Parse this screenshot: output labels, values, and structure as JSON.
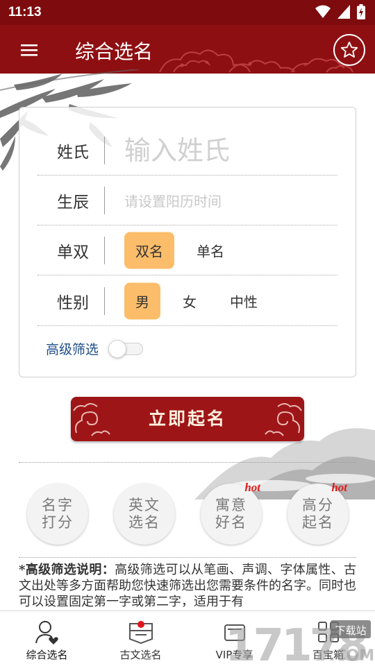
{
  "status_bar": {
    "time": "11:13"
  },
  "app_bar": {
    "title": "综合选名"
  },
  "form": {
    "surname": {
      "label": "姓氏",
      "placeholder": "输入姓氏"
    },
    "birth": {
      "label": "生辰",
      "placeholder": "请设置阳历时间"
    },
    "count": {
      "label": "单双",
      "options": [
        "双名",
        "单名"
      ],
      "selected": "双名"
    },
    "gender": {
      "label": "性别",
      "options": [
        "男",
        "女",
        "中性"
      ],
      "selected": "男"
    },
    "advanced": {
      "label": "高级筛选",
      "enabled": false
    }
  },
  "action_button": {
    "label": "立即起名"
  },
  "features": [
    {
      "line1": "名字",
      "line2": "打分",
      "badge": ""
    },
    {
      "line1": "英文",
      "line2": "选名",
      "badge": ""
    },
    {
      "line1": "寓意",
      "line2": "好名",
      "badge": "hot"
    },
    {
      "line1": "高分",
      "line2": "起名",
      "badge": "hot"
    }
  ],
  "description": {
    "head": "*高级筛选说明：",
    "body": "高级筛选可以从笔画、声调、字体属性、古文出处等多方面帮助您快速筛选出您需要条件的名字。同时也可以设置固定第一字或第二字，适用于有"
  },
  "tabs": [
    {
      "label": "综合选名",
      "icon": "person-heart-icon",
      "active": true
    },
    {
      "label": "古文选名",
      "icon": "ancient-book-icon",
      "active": false
    },
    {
      "label": "VIP专享",
      "icon": "vip-crown-icon",
      "active": false
    },
    {
      "label": "百宝箱",
      "icon": "grid-box-icon",
      "active": false
    }
  ],
  "watermark": {
    "text": "17178",
    "badge": "下载站",
    "suffix": ".COM"
  },
  "colors": {
    "brand": "#8e0f12",
    "selected": "#fbbd6a",
    "link": "#1e4d8a",
    "hot": "#e01c1c"
  }
}
